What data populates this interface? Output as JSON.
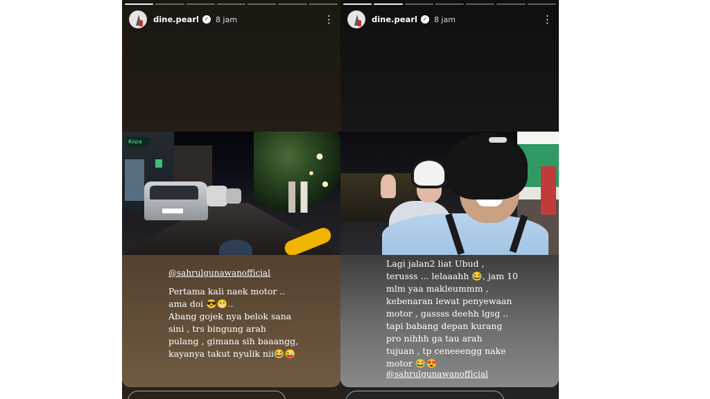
{
  "stories": [
    {
      "username": "dine.pearl",
      "verified_mark": "✓",
      "time": "8 jam",
      "more_icon": "⋮",
      "progress": {
        "total_segments": 7,
        "completed_segments": 1
      },
      "photo_description_icon": "night-street-photo",
      "shop_sign": "Kopa",
      "mention": "@sahrulgunawanofficial",
      "caption": "Pertama kali naek motor ..\nama doi 😎😁..\nAbang gojek nya  belok sana\nsini , trs bingung arah\npulang , gimana sih baaangg,\nkayanya takut nyulik nii😂😜"
    },
    {
      "username": "dine.pearl",
      "verified_mark": "✓",
      "time": "8 jam",
      "more_icon": "⋮",
      "progress": {
        "total_segments": 7,
        "completed_segments": 2
      },
      "photo_description_icon": "motorbike-selfie-photo",
      "caption": "Lagi jalan2 liat Ubud ,\nterusss ... lelaaahh 😂, jam 10\nmlm yaa makleummm ,\nkebenaran lewat penyewaan\nmotor , gassss deehh lgsg ..\ntapi babang depan kurang\npro nihhh ga tau arah\ntujuan , tp ceneeengg nake\nmotor 😂😍",
      "mention": "@sahrulgunawanofficial"
    }
  ],
  "colors": {
    "background": "#ffffff",
    "story1_caption_bg": "#705a42",
    "story2_caption_bg": "#6a6a6a",
    "text": "#ffffff"
  }
}
